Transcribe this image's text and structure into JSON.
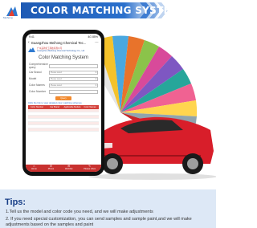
{
  "banner": {
    "title": "COLOR MATCHING SYSTEM",
    "brand_label": "Meihong"
  },
  "phone": {
    "status_time": "9:41",
    "status_right": "4G 85%",
    "app_title": "Guangzhou Meihong Chemical Tec...",
    "company_cn": "广州美鸿化工科技有限公司",
    "company_en": "Guangzhou Meihong Chemical Technology Co., Ltd",
    "page_title": "Color Matching System",
    "form": [
      {
        "label": "Comprehensive query",
        "value": ""
      },
      {
        "label": "Car Brand",
        "value": "Please select"
      },
      {
        "label": "Model",
        "value": "Please select"
      },
      {
        "label": "Color Names",
        "value": "Please select"
      },
      {
        "label": "Color Number",
        "value": ""
      }
    ],
    "query_button": "Query",
    "hint": "Click the link to view detailed color matching schemes",
    "table_headers": [
      "Color Number",
      "Car Brand",
      "Applicable Models",
      "Color Names"
    ],
    "table_rows": [
      [
        "",
        "",
        "",
        ""
      ],
      [
        "",
        "",
        "",
        ""
      ],
      [
        "",
        "",
        "",
        ""
      ],
      [
        "",
        "",
        "",
        ""
      ],
      [
        "",
        "",
        "",
        ""
      ],
      [
        "",
        "",
        "",
        ""
      ],
      [
        "",
        "",
        "",
        ""
      ]
    ],
    "tabs": [
      {
        "label": "Home",
        "icon": "home-icon",
        "glyph": "⌂"
      },
      {
        "label": "Phone",
        "icon": "phone-icon",
        "glyph": "✆"
      },
      {
        "label": "WeChat",
        "icon": "wechat-icon",
        "glyph": "✉"
      },
      {
        "label": "Please inbox",
        "icon": "message-icon",
        "glyph": "✎"
      }
    ]
  },
  "tips": {
    "title": "Tips:",
    "items": [
      "1.Tell us the model and color code you need, and we will make adjustments",
      "2. If you need special customization, you can send samples and sample paint,and we will make adjustments based on the samples and paint"
    ]
  },
  "colors": {
    "banner_blue": "#1e5ab4",
    "car_red": "#d81e2a",
    "tab_red": "#c8312f",
    "tips_bg": "#dde8f6",
    "tips_title": "#163d86",
    "query_orange": "#f28a2e"
  }
}
